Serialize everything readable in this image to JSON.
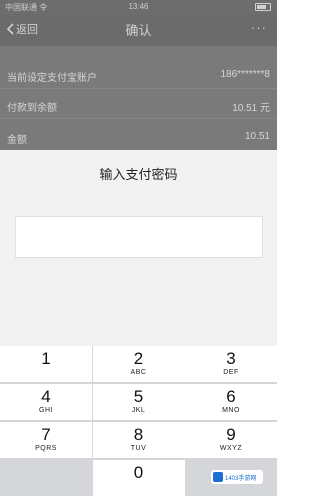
{
  "status_bar": {
    "carrier": "中国联通 令",
    "time": "13:46"
  },
  "nav": {
    "back_label": "返回",
    "title": "确认",
    "more": "···"
  },
  "info": {
    "rows": [
      {
        "label": "当前设定支付宝账户",
        "value": "186*******8"
      },
      {
        "label": "付款到余额",
        "value": "10.51 元"
      },
      {
        "label": "金额",
        "value": "10.51"
      }
    ]
  },
  "sheet": {
    "title": "输入支付密码",
    "password_value": ""
  },
  "keypad": {
    "keys": [
      {
        "num": "1",
        "letters": ""
      },
      {
        "num": "2",
        "letters": "ABC"
      },
      {
        "num": "3",
        "letters": "DEF"
      },
      {
        "num": "4",
        "letters": "GHI"
      },
      {
        "num": "5",
        "letters": "JKL"
      },
      {
        "num": "6",
        "letters": "MNO"
      },
      {
        "num": "7",
        "letters": "PQRS"
      },
      {
        "num": "8",
        "letters": "TUV"
      },
      {
        "num": "9",
        "letters": "WXYZ"
      },
      {
        "num": "0",
        "letters": ""
      }
    ]
  },
  "watermark": {
    "text": "1403手游网"
  },
  "colors": {
    "overlay": "#6b6b6b",
    "sheet": "#f2f2f2",
    "keypad_bg": "#d4d6d9",
    "key": "#ffffff"
  }
}
